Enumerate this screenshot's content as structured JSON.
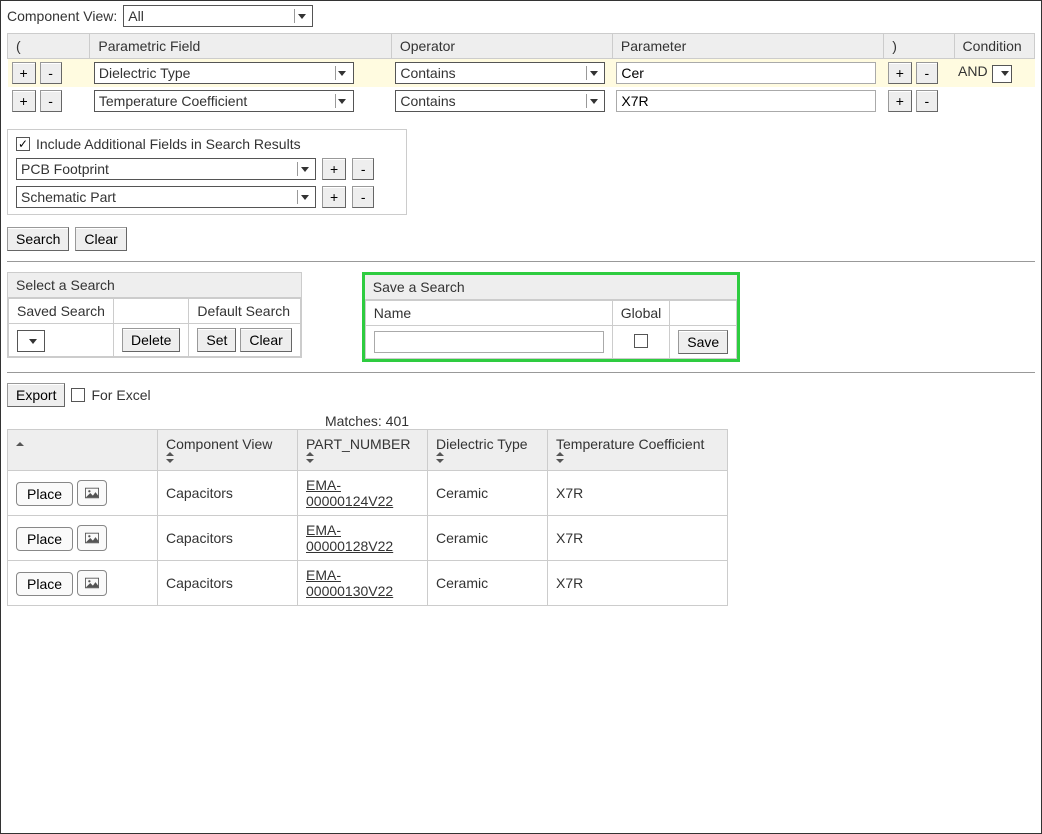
{
  "component_view": {
    "label": "Component View:",
    "value": "All"
  },
  "query_headers": {
    "open_paren": "(",
    "param_field": "Parametric Field",
    "operator": "Operator",
    "parameter": "Parameter",
    "close_paren": ")",
    "condition": "Condition"
  },
  "query_rows": [
    {
      "field": "Dielectric Type",
      "op": "Contains",
      "param": "Cer",
      "condition": "AND",
      "highlight": true
    },
    {
      "field": "Temperature Coefficient",
      "op": "Contains",
      "param": "X7R",
      "condition": "",
      "highlight": false
    }
  ],
  "buttons": {
    "plus": "+",
    "minus": "-",
    "search": "Search",
    "clear": "Clear",
    "delete": "Delete",
    "set": "Set",
    "save": "Save",
    "export": "Export",
    "place": "Place"
  },
  "additional_fields": {
    "checkbox_label": "Include Additional Fields in Search Results",
    "checked": true,
    "rows": [
      "PCB Footprint",
      "Schematic Part"
    ]
  },
  "select_search": {
    "title": "Select a Search",
    "saved_label": "Saved Search",
    "default_label": "Default Search"
  },
  "save_search": {
    "title": "Save a Search",
    "name_label": "Name",
    "global_label": "Global",
    "name_value": "",
    "global_checked": false
  },
  "export": {
    "for_excel_label": "For Excel",
    "for_excel_checked": false
  },
  "matches": {
    "label": "Matches:",
    "count": "401"
  },
  "results_headers": {
    "actions": "",
    "component_view": "Component View",
    "part_number": "PART_NUMBER",
    "dielectric_type": "Dielectric Type",
    "temp_coeff": "Temperature Coefficient"
  },
  "results_rows": [
    {
      "component_view": "Capacitors",
      "part_number": "EMA-00000124V22",
      "dielectric_type": "Ceramic",
      "temp_coeff": "X7R"
    },
    {
      "component_view": "Capacitors",
      "part_number": "EMA-00000128V22",
      "dielectric_type": "Ceramic",
      "temp_coeff": "X7R"
    },
    {
      "component_view": "Capacitors",
      "part_number": "EMA-00000130V22",
      "dielectric_type": "Ceramic",
      "temp_coeff": "X7R"
    }
  ]
}
